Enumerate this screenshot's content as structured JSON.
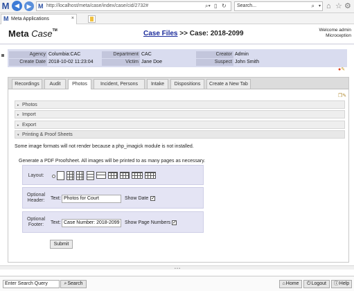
{
  "browser": {
    "url": "http://localhost/meta/case/index/case/cid/2732#",
    "search_placeholder": "Search...",
    "tab_title": "Meta Applications",
    "tab_close": "×"
  },
  "header": {
    "brand_meta": "Meta",
    "brand_case": "Case",
    "brand_tm": "TM",
    "crumb_link": "Case Files",
    "crumb_rest": " >> Case: 2018-2099",
    "welcome_line1": "Welcome admin",
    "welcome_line2": "Microception"
  },
  "summary": {
    "agency_label": "Agency",
    "agency_value": "Columbia:CAC",
    "department_label": "Department",
    "department_value": "CAC",
    "creator_label": "Creator",
    "creator_value": "Admin",
    "create_date_label": "Create Date",
    "create_date_value": "2018-10-02 11:23:04",
    "victim_label": "Victim",
    "victim_value": "Jane Doe",
    "suspect_label": "Suspect",
    "suspect_value": "John Smith"
  },
  "tabs": [
    {
      "label": "Recordings"
    },
    {
      "label": "Audit"
    },
    {
      "label": "Photos"
    },
    {
      "label": "Incident, Persons"
    },
    {
      "label": "Intake"
    },
    {
      "label": "Dispositions"
    },
    {
      "label": "Create a New Tab"
    }
  ],
  "active_tab": "Photos",
  "accordion": [
    {
      "label": "Photos",
      "open": false
    },
    {
      "label": "Import",
      "open": false
    },
    {
      "label": "Export",
      "open": false
    },
    {
      "label": "Printing & Proof Sheets",
      "open": true
    }
  ],
  "printing": {
    "notice": "Some image formats will not render because a php_imagick module is not installed.",
    "generate_text": "Generate a PDF Proofsheet. All images will be printed to as many pages as necessary.",
    "layout_label": "Layout:",
    "header_label_1": "Optional",
    "header_label_2": "Header:",
    "footer_label_1": "Optional",
    "footer_label_2": "Footer:",
    "text_label": "Text:",
    "header_text_value": "Photos for Court",
    "show_date_label": "Show Date",
    "show_date_checked": true,
    "footer_text_value": "Case Number: 2018-2099",
    "show_page_numbers_label": "Show Page Numbers",
    "show_page_numbers_checked": true,
    "submit_label": "Submit"
  },
  "bottom": {
    "search_placeholder": "Enter Search Query",
    "search_button": "Search",
    "home_button": "Home",
    "logout_button": "Logout",
    "help_button": "Help"
  }
}
